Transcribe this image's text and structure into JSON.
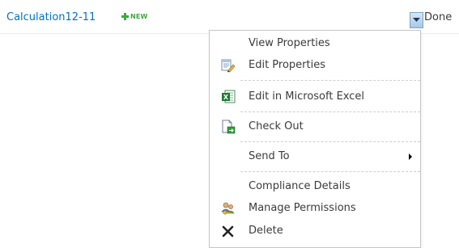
{
  "item": {
    "title": "Calculation12-11",
    "new_badge": "NEW"
  },
  "done_label": "Done",
  "menu": {
    "items": [
      {
        "label": "View Properties",
        "icon": null
      },
      {
        "label": "Edit Properties",
        "icon": "edit-properties-icon"
      },
      {
        "label": "Edit in Microsoft Excel",
        "icon": "excel-icon"
      },
      {
        "label": "Check Out",
        "icon": "check-out-icon"
      },
      {
        "label": "Send To",
        "icon": null,
        "has_submenu": true
      },
      {
        "label": "Compliance Details",
        "icon": null
      },
      {
        "label": "Manage Permissions",
        "icon": "manage-permissions-icon"
      },
      {
        "label": "Delete",
        "icon": "delete-icon"
      }
    ]
  },
  "colors": {
    "link": "#0072c6",
    "new_badge": "#3fa83f",
    "excel_green": "#1e7b34"
  }
}
